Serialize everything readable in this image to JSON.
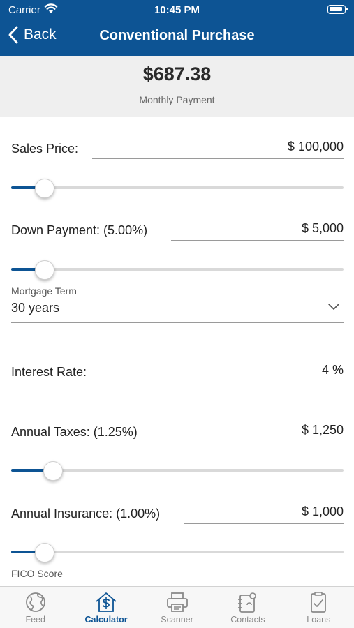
{
  "status_bar": {
    "carrier": "Carrier",
    "time": "10:45 PM"
  },
  "nav": {
    "back_label": "Back",
    "title": "Conventional Purchase"
  },
  "summary": {
    "amount": "$687.38",
    "caption": "Monthly Payment"
  },
  "form": {
    "sales_price": {
      "label": "Sales Price:",
      "value": "$ 100,000",
      "slider_fraction": 0.1
    },
    "down_payment": {
      "label": "Down Payment: (5.00%)",
      "value": "$ 5,000",
      "slider_fraction": 0.1
    },
    "mortgage_term": {
      "label": "Mortgage Term",
      "value": "30 years"
    },
    "interest_rate": {
      "label": "Interest Rate:",
      "value": "4 %"
    },
    "annual_taxes": {
      "label": "Annual Taxes: (1.25%)",
      "value": "$ 1,250",
      "slider_fraction": 0.125
    },
    "annual_insurance": {
      "label": "Annual Insurance: (1.00%)",
      "value": "$ 1,000",
      "slider_fraction": 0.1
    },
    "fico_score": {
      "label": "FICO Score"
    }
  },
  "tabs": [
    {
      "label": "Feed",
      "icon": "globe-icon",
      "active": false
    },
    {
      "label": "Calculator",
      "icon": "house-dollar-icon",
      "active": true
    },
    {
      "label": "Scanner",
      "icon": "printer-icon",
      "active": false
    },
    {
      "label": "Contacts",
      "icon": "contacts-icon",
      "active": false
    },
    {
      "label": "Loans",
      "icon": "clipboard-check-icon",
      "active": false
    }
  ],
  "colors": {
    "primary": "#0d5494",
    "summary_bg": "#efefef",
    "track": "#d9d9d9",
    "tab_inactive": "#8a8a8a"
  }
}
